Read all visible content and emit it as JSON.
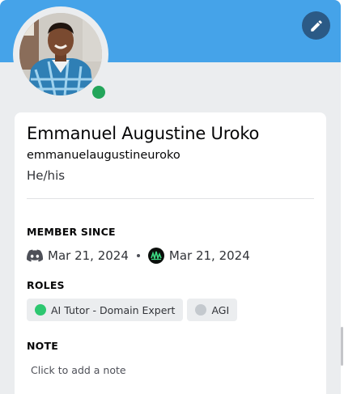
{
  "profile": {
    "display_name": "Emmanuel Augustine Uroko",
    "username": "emmanuelaugustineuroko",
    "pronouns": "He/his",
    "status": "online",
    "status_color": "#23a55a",
    "banner_color": "#45a3e9"
  },
  "edit_button": {
    "icon": "pencil-icon"
  },
  "member_since": {
    "title": "MEMBER SINCE",
    "discord_date": "Mar 21, 2024",
    "server_date": "Mar 21, 2024",
    "discord_icon": "discord-icon",
    "server_icon": "server-icon"
  },
  "roles": {
    "title": "ROLES",
    "items": [
      {
        "name": "AI Tutor - Domain Expert",
        "color": "#2dc770"
      },
      {
        "name": "AGI",
        "color": "#c4c9ce"
      }
    ]
  },
  "note": {
    "title": "NOTE",
    "placeholder": "Click to add a note"
  }
}
